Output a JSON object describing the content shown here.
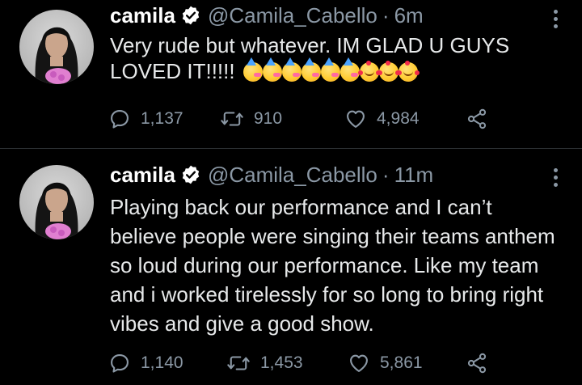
{
  "colors": {
    "background": "#000000",
    "primary_text": "#e7e9ea",
    "secondary_text": "#8b98a5",
    "verified": "#ffffff",
    "divider": "#2f3336"
  },
  "tweets": [
    {
      "author_name": "camila",
      "handle": "@Camila_Cabello",
      "separator": "·",
      "time": "6m",
      "text": "Very rude but whatever. IM GLAD U GUYS LOVED IT!!!!!",
      "emojis": [
        "partying-face",
        "partying-face",
        "partying-face",
        "partying-face",
        "partying-face",
        "partying-face",
        "smiling-face-with-hearts",
        "smiling-face-with-hearts",
        "smiling-face-with-hearts"
      ],
      "replies": "1,137",
      "retweets": "910",
      "likes": "4,984"
    },
    {
      "author_name": "camila",
      "handle": "@Camila_Cabello",
      "separator": "·",
      "time": "11m",
      "text": "Playing back our performance and I can’t believe people were singing their teams anthem so loud during our performance. Like my team and i worked tirelessly for so long to bring right vibes and give a good show.",
      "replies": "1,140",
      "retweets": "1,453",
      "likes": "5,861"
    }
  ],
  "icons": {
    "verified": "verified-badge-icon",
    "more": "more-options-icon",
    "reply": "reply-icon",
    "retweet": "retweet-icon",
    "like": "heart-icon",
    "share": "share-icon"
  }
}
